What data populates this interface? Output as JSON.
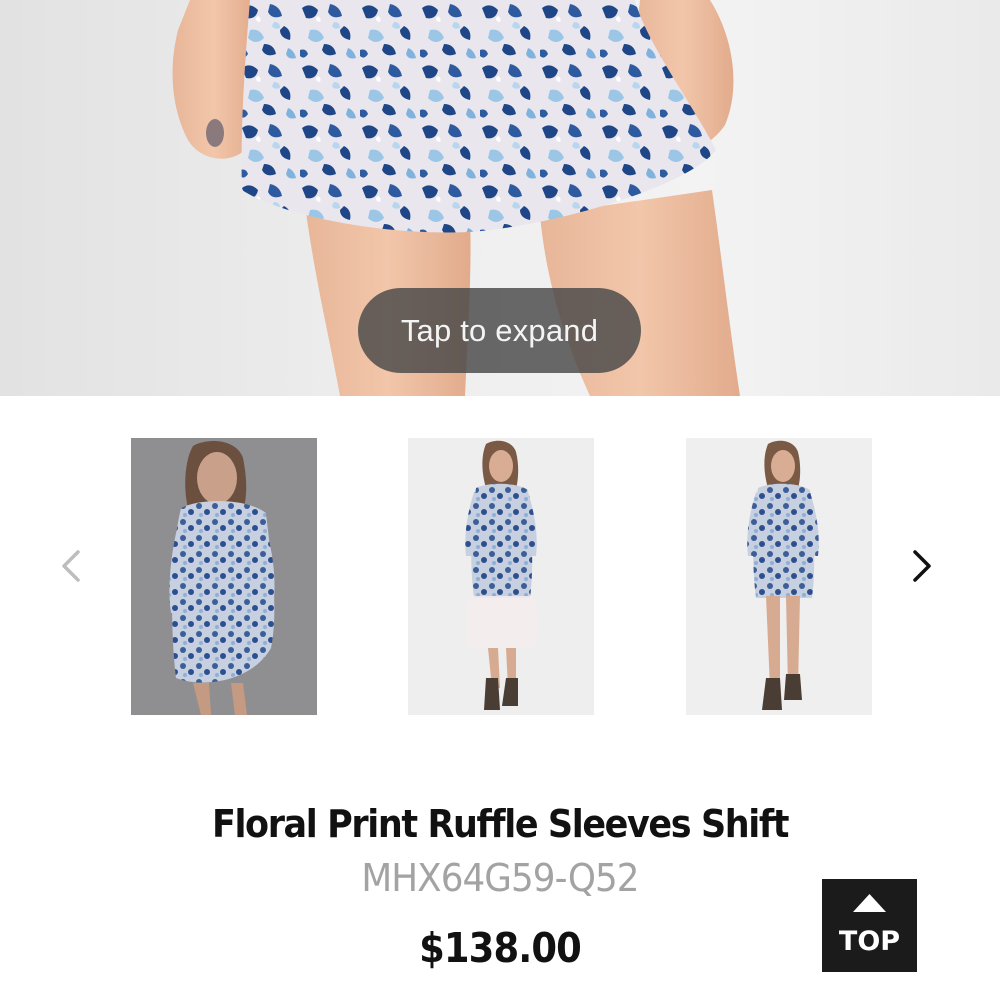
{
  "hero": {
    "expand_hint": "Tap to expand"
  },
  "carousel": {
    "prev_icon": "chevron-left-icon",
    "next_icon": "chevron-right-icon",
    "thumbnails": [
      {
        "name": "thumbnail-1"
      },
      {
        "name": "thumbnail-2"
      },
      {
        "name": "thumbnail-3"
      }
    ]
  },
  "product": {
    "title": "Floral Print Ruffle Sleeves Shift",
    "sku": "MHX64G59-Q52",
    "price": "$138.00"
  },
  "back_to_top": {
    "label": "TOP",
    "icon": "triangle-up-icon"
  },
  "colors": {
    "text_primary": "#111111",
    "text_secondary": "#a3a3a3",
    "dress_blue": "#2e4f8f",
    "top_button_bg": "#1b1b1b"
  }
}
